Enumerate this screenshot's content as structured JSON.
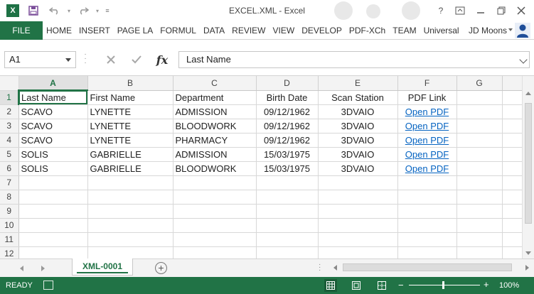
{
  "window": {
    "title": "EXCEL.XML - Excel",
    "app_icon": "X"
  },
  "ribbon": {
    "file_tab": "FILE",
    "tabs": [
      "HOME",
      "INSERT",
      "PAGE LA",
      "FORMUL",
      "DATA",
      "REVIEW",
      "VIEW",
      "DEVELOP",
      "PDF-XCh",
      "TEAM",
      "Universal"
    ],
    "user_name": "JD Moons"
  },
  "formula_bar": {
    "name_box": "A1",
    "fx_label": "fx",
    "content": "Last Name"
  },
  "sheet": {
    "columns": [
      "A",
      "B",
      "C",
      "D",
      "E",
      "F",
      "G"
    ],
    "row_numbers": [
      "1",
      "2",
      "3",
      "4",
      "5",
      "6",
      "7",
      "8",
      "9",
      "10",
      "11",
      "12"
    ],
    "header_row": [
      "Last Name",
      "First Name",
      "Department",
      "Birth Date",
      "Scan Station",
      "PDF Link"
    ],
    "rows": [
      [
        "SCAVO",
        "LYNETTE",
        "ADMISSION",
        "09/12/1962",
        "3DVAIO",
        "Open PDF"
      ],
      [
        "SCAVO",
        "LYNETTE",
        "BLOODWORK",
        "09/12/1962",
        "3DVAIO",
        "Open PDF"
      ],
      [
        "SCAVO",
        "LYNETTE",
        "PHARMACY",
        "09/12/1962",
        "3DVAIO",
        "Open PDF"
      ],
      [
        "SOLIS",
        "GABRIELLE",
        "ADMISSION",
        "15/03/1975",
        "3DVAIO",
        "Open PDF"
      ],
      [
        "SOLIS",
        "GABRIELLE",
        "BLOODWORK",
        "15/03/1975",
        "3DVAIO",
        "Open PDF"
      ]
    ],
    "active_cell": "A1"
  },
  "sheet_tabs": {
    "active": "XML-0001",
    "add_label": "+"
  },
  "status_bar": {
    "status": "READY",
    "zoom": "100%",
    "zoom_minus": "−",
    "zoom_plus": "+"
  },
  "colors": {
    "excel_green": "#217346",
    "link_blue": "#0563c1"
  }
}
